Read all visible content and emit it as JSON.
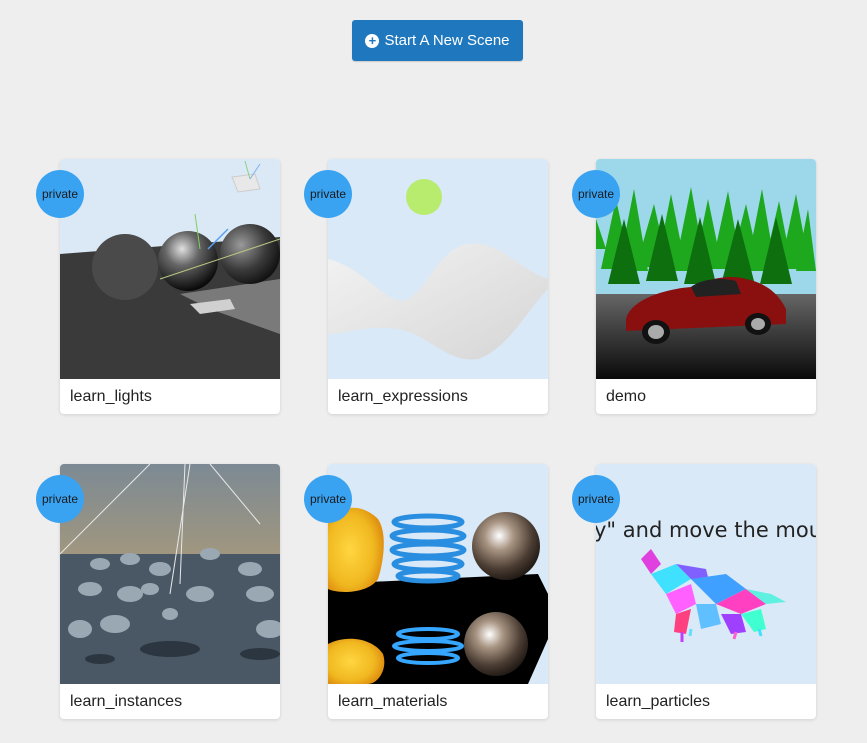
{
  "toolbar": {
    "new_scene_label": "Start A New Scene",
    "new_scene_icon": "plus-circle-icon"
  },
  "scenes": [
    {
      "name": "learn_lights",
      "badge": "private"
    },
    {
      "name": "learn_expressions",
      "badge": "private"
    },
    {
      "name": "demo",
      "badge": "private"
    },
    {
      "name": "learn_instances",
      "badge": "private"
    },
    {
      "name": "learn_materials",
      "badge": "private"
    },
    {
      "name": "learn_particles",
      "badge": "private",
      "thumb_text": "y\" and move the mouse"
    }
  ],
  "colors": {
    "accent": "#1f78be",
    "badge": "#39a3f2",
    "background": "#eeeeee"
  }
}
